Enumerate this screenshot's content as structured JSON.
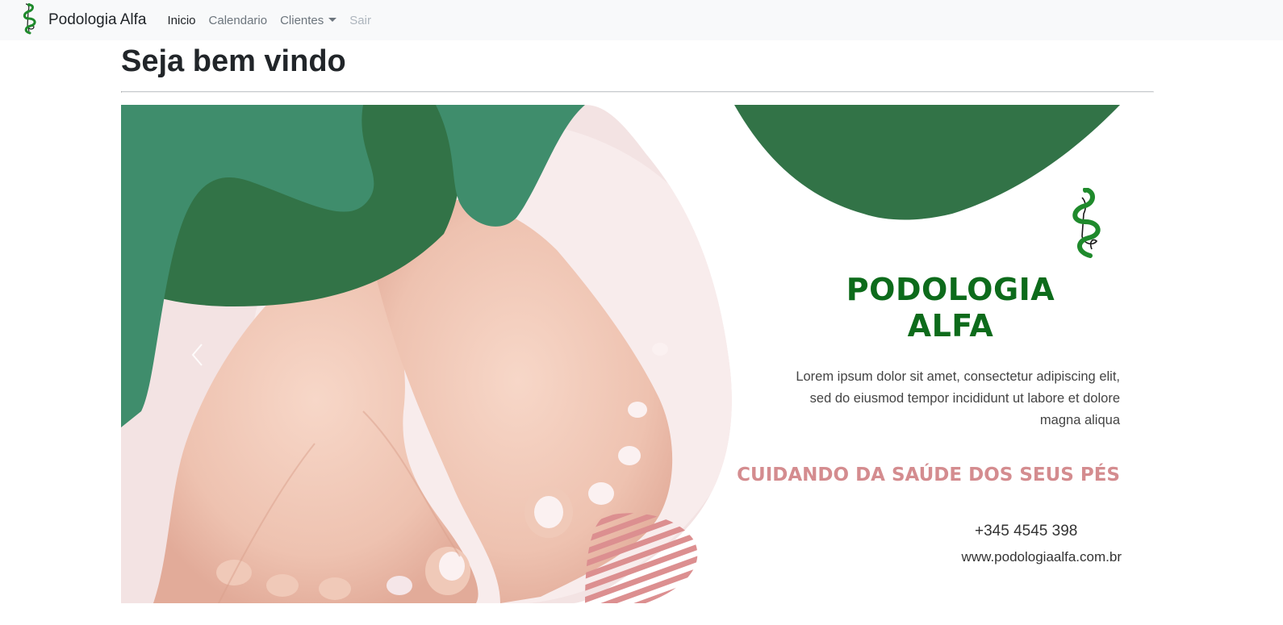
{
  "navbar": {
    "brand": "Podologia Alfa",
    "brand_icon": "snake-foot-logo-icon",
    "links": {
      "inicio": "Inicio",
      "calendario": "Calendario",
      "clientes": "Clientes",
      "sair": "Sair"
    }
  },
  "page": {
    "title": "Seja bem vindo"
  },
  "banner": {
    "title_line1": "PODOLOGIA",
    "title_line2": "ALFA",
    "description": "Lorem ipsum dolor sit amet, consectetur adipiscing elit, sed do eiusmod tempor incididunt ut labore et dolore magna aliqua",
    "tagline": "CUIDANDO DA SAÚDE DOS SEUS PÉS",
    "phone": "+345 4545 398",
    "website": "www.podologiaalfa.com.br",
    "prev_icon": "chevron-left-icon",
    "photo_icon": "feet-photo",
    "colors": {
      "green_dark": "#327347",
      "green_light": "#3f8d6c",
      "green_logo": "#0d6b1b",
      "pink_text": "#d48c8f",
      "pink_stripes": "#dc8f90"
    }
  }
}
